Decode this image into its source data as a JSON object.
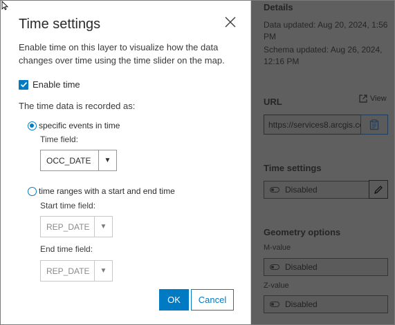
{
  "dialog": {
    "title": "Time settings",
    "description": "Enable time on this layer to visualize how the data changes over time using the time slider on the map.",
    "enable_time_label": "Enable time",
    "enable_time_checked": true,
    "recorded_as_label": "The time data is recorded as:",
    "options": {
      "specific_events": {
        "label": "specific events in time",
        "checked": true,
        "time_field_label": "Time field:",
        "time_field_value": "OCC_DATE"
      },
      "time_ranges": {
        "label": "time ranges with a start and end time",
        "checked": false,
        "start_field_label": "Start time field:",
        "start_field_value": "REP_DATE",
        "end_field_label": "End time field:",
        "end_field_value": "REP_DATE"
      }
    },
    "ok_label": "OK",
    "cancel_label": "Cancel"
  },
  "side_panel": {
    "details_heading": "Details",
    "data_updated": "Data updated: Aug 20, 2024, 1:56 PM",
    "schema_updated": "Schema updated: Aug 26, 2024, 12:16 PM",
    "url_heading": "URL",
    "view_label": "View",
    "url_value": "https://services8.arcgis.com",
    "time_settings_heading": "Time settings",
    "time_settings_status": "Disabled",
    "geometry_heading": "Geometry options",
    "m_value_label": "M-value",
    "m_value_status": "Disabled",
    "z_value_label": "Z-value",
    "z_value_status": "Disabled"
  },
  "icons": {
    "close": "close-icon",
    "check": "checkmark-icon",
    "copy": "copy-icon",
    "edit": "pencil-icon",
    "toggle": "toggle-icon",
    "launch": "launch-icon",
    "dropdown": "dropdown-arrow-icon"
  },
  "colors": {
    "accent": "#007ac2",
    "overlay": "#5f5f5f"
  }
}
